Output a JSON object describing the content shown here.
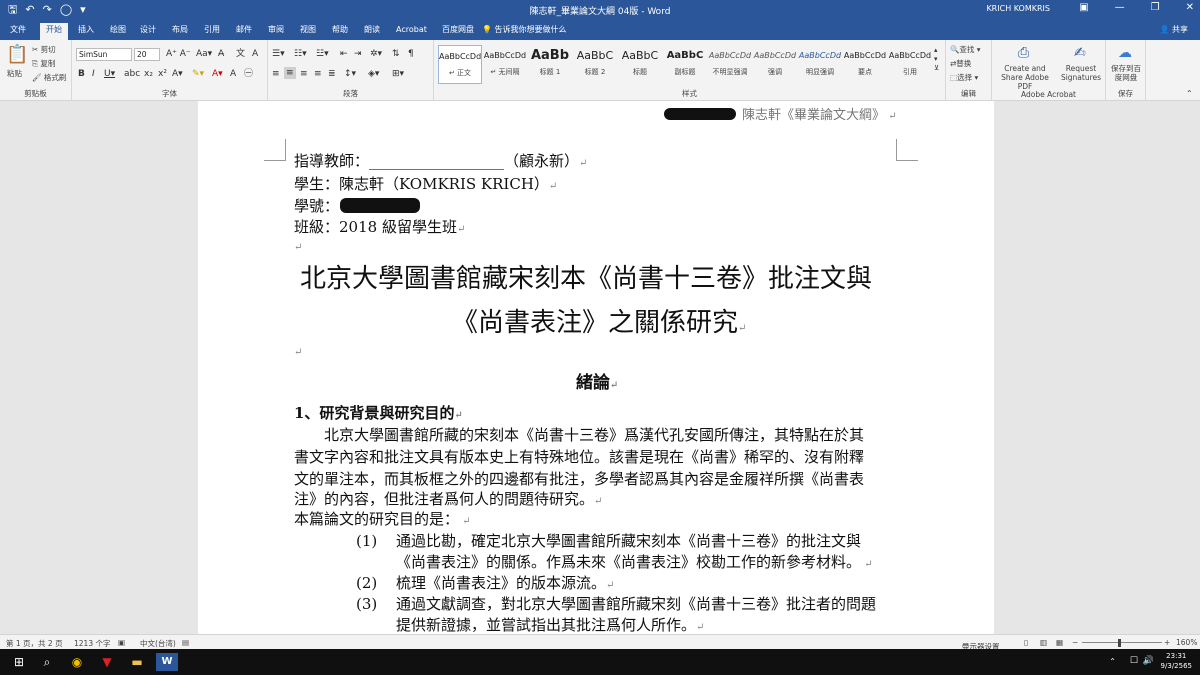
{
  "window": {
    "title": "陳志軒_畢業論文大綱 04版 - Word",
    "user": "KRICH KOMKRIS"
  },
  "tabs": [
    "文件",
    "开始",
    "插入",
    "绘图",
    "设计",
    "布局",
    "引用",
    "邮件",
    "审阅",
    "视图",
    "帮助",
    "朗读",
    "Acrobat",
    "百度网盘"
  ],
  "tell_me": "告诉我你想要做什么",
  "share": "共享",
  "clipboard": {
    "paste": "粘贴",
    "cut": "剪切",
    "copy": "复制",
    "format": "格式刷",
    "label": "剪贴板"
  },
  "font": {
    "name": "SimSun",
    "size": "20",
    "label": "字体"
  },
  "paragraph": {
    "label": "段落"
  },
  "styles": {
    "label": "样式",
    "items": [
      {
        "preview": "AaBbCcDd",
        "name": "↵ 正文"
      },
      {
        "preview": "AaBbCcDd",
        "name": "↵ 无间隔"
      },
      {
        "preview": "AaBb",
        "name": "标题 1"
      },
      {
        "preview": "AaBbC",
        "name": "标题 2"
      },
      {
        "preview": "AaBbC",
        "name": "标题"
      },
      {
        "preview": "AaBbC",
        "name": "副标题"
      },
      {
        "preview": "AaBbCcDd",
        "name": "不明显强调"
      },
      {
        "preview": "AaBbCcDd",
        "name": "强调"
      },
      {
        "preview": "AaBbCcDd",
        "name": "明显强调"
      },
      {
        "preview": "AaBbCcDd",
        "name": "要点"
      },
      {
        "preview": "AaBbCcDd",
        "name": "引用"
      }
    ]
  },
  "editing": {
    "find": "查找",
    "replace": "替换",
    "select": "选择",
    "label": "编辑"
  },
  "acrobat": {
    "create": "Create and Share Adobe PDF",
    "request": "Request Signatures",
    "label": "Adobe Acrobat"
  },
  "save": {
    "btn": "保存到百度网盘",
    "label": "保存"
  },
  "doc": {
    "header": "陳志軒《畢業論文大綱》",
    "advisor": "指導教師：__________________（顧永新）",
    "student": "學生：陳志軒（KOMKRIS KRICH）",
    "student_id": "學號：",
    "class_line": "班級：2018 級留學生班",
    "title1": "北京大學圖書館藏宋刻本《尚書十三卷》批注文與",
    "title2": "《尚書表注》之關係研究",
    "section": "緒論",
    "sub1": "1、研究背景與研究目的",
    "para": [
      "北京大學圖書館所藏的宋刻本《尚書十三卷》爲漢代孔安國所傳注，其特點在於其",
      "書文字內容和批注文具有版本史上有特殊地位。該書是現在《尚書》稀罕的、沒有附釋",
      "文的單注本，而其板框之外的四邊都有批注，多學者認爲其內容是金履祥所撰《尚書表",
      "注》的內容，但批注者爲何人的問題待研究。"
    ],
    "purpose": "本篇論文的研究目的是：",
    "items": [
      {
        "n": "(1)",
        "l1": "通過比勘，確定北京大學圖書館所藏宋刻本《尚書十三卷》的批注文與",
        "l2": "《尚書表注》的關係。作爲未來《尚書表注》校勘工作的新參考材料。"
      },
      {
        "n": "(2)",
        "l1": "梳理《尚書表注》的版本源流。",
        "l2": ""
      },
      {
        "n": "(3)",
        "l1": "通過文獻調查，對北京大學圖書館所藏宋刻《尚書十三卷》批注者的問題",
        "l2": "提供新證據，並嘗試指出其批注爲何人所作。"
      }
    ]
  },
  "status": {
    "page": "第 1 页，共 2 页",
    "words": "1213 个字",
    "lang": "中文(台湾)",
    "display": "显示器设置",
    "zoom": "160%"
  },
  "clock": {
    "time": "23:31",
    "date": "9/3/2565"
  }
}
